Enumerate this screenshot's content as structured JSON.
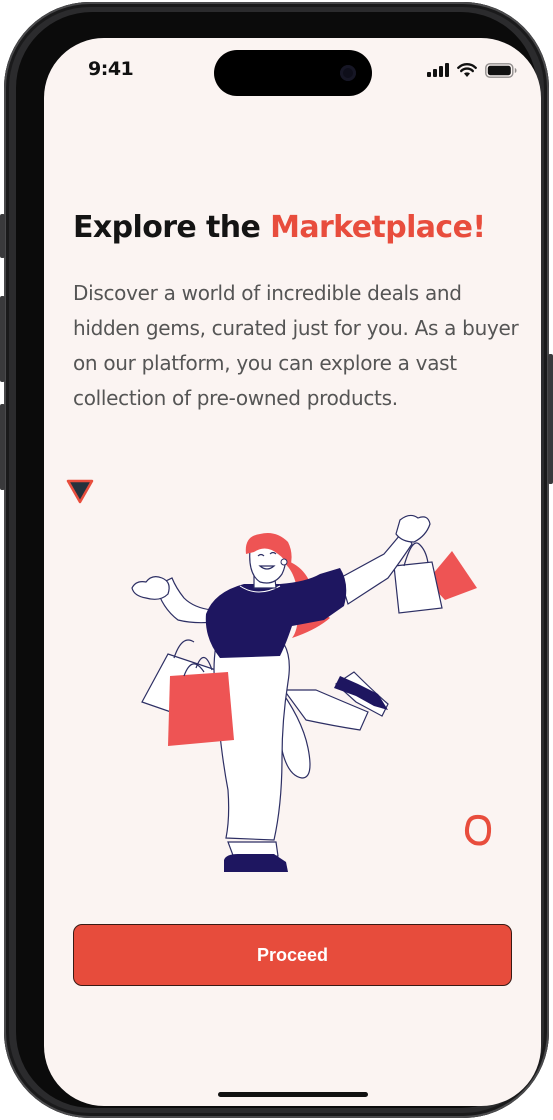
{
  "status_bar": {
    "time": "9:41",
    "icons": [
      "cellular-signal-icon",
      "wifi-icon",
      "battery-icon"
    ]
  },
  "onboarding": {
    "title_part1": "Explore the ",
    "title_accent": "Marketplace!",
    "description": "Discover a world of incredible deals and hidden gems, curated just for you. As a buyer on our platform, you can explore a vast collection of pre-owned products.",
    "illustration": "woman-with-shopping-bags-illustration",
    "proceed_label": "Proceed"
  },
  "colors": {
    "accent": "#e74c3c",
    "background": "#fbf4f2",
    "navy": "#1e1660",
    "text_dark": "#141414",
    "text_body": "#555555"
  }
}
